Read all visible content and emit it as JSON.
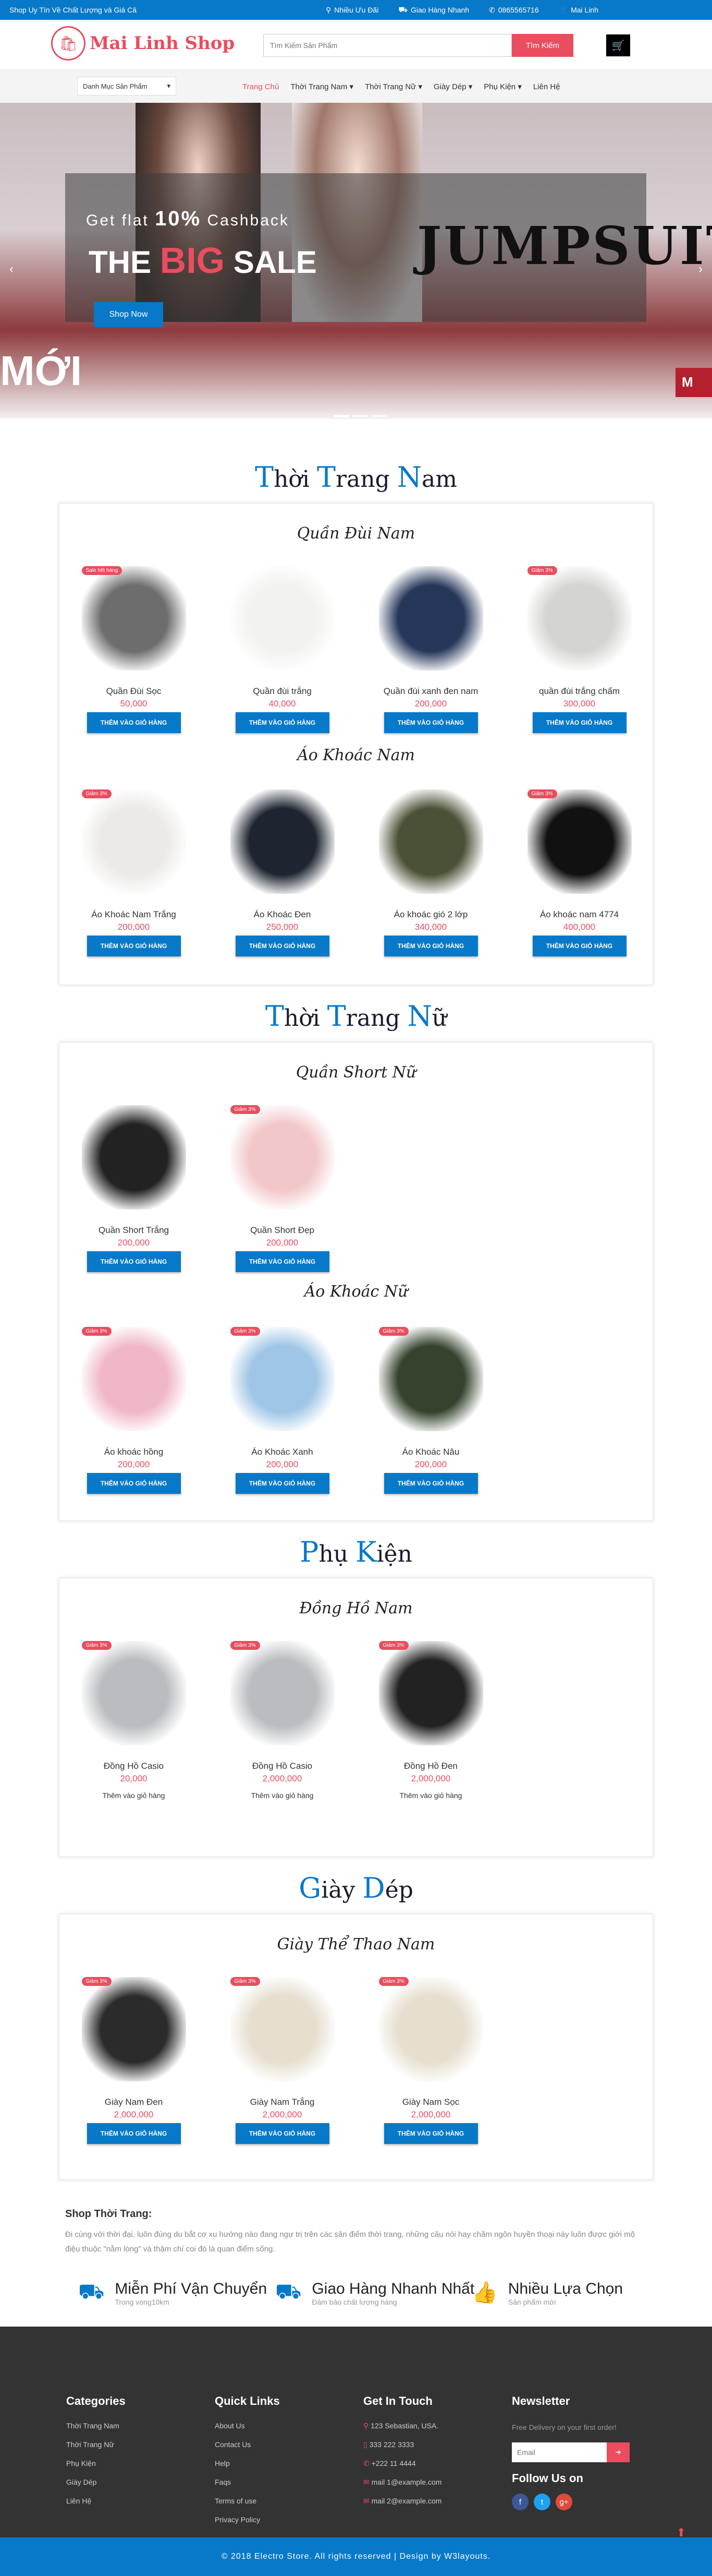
{
  "topbar": {
    "tagline": "Shop Uy Tín Về Chất Lượng và Giá Cả",
    "links": [
      {
        "icon": "map-marker-icon",
        "label": "Nhiều Ưu Đãi"
      },
      {
        "icon": "truck-icon",
        "label": "Giao Hàng Nhanh"
      },
      {
        "icon": "phone-icon",
        "label": "0865565716"
      },
      {
        "icon": "user-icon",
        "label": "Mai Linh"
      }
    ]
  },
  "header": {
    "logo_text": "Mai Linh Shop",
    "search_placeholder": "Tìm Kiếm Sản Phẩm",
    "search_button": "Tìm Kiếm"
  },
  "nav": {
    "category_dropdown": "Danh Mục Sản Phẩm",
    "menu": [
      "Trang Chủ",
      "Thời Trang Nam",
      "Thời Trang Nữ",
      "Giày Dép",
      "Phụ Kiện",
      "Liên Hệ"
    ],
    "active_index": 0
  },
  "banner": {
    "cashback_pre": "Get flat",
    "cashback_pct": "10%",
    "cashback_post": "Cashback",
    "sale_the": "THE",
    "sale_big": "BIG",
    "sale_word": "SALE",
    "jumpsuit": "JUMPSUIT",
    "shop_now": "Shop Now",
    "moi": "MỚI",
    "side_tab": "M"
  },
  "sections": {
    "men": {
      "title": "Thời Trang Nam",
      "cap1": "T",
      "rest1": "hời ",
      "cap2": "T",
      "rest2": "rang ",
      "cap3": "N",
      "rest3": "am"
    },
    "women": {
      "cap1": "T",
      "rest1": "hời ",
      "cap2": "T",
      "rest2": "rang ",
      "cap3": "N",
      "rest3": "ữ"
    },
    "acc": {
      "cap1": "P",
      "rest1": "hụ ",
      "cap2": "K",
      "rest2": "iện"
    },
    "shoes": {
      "cap1": "G",
      "rest1": "iày ",
      "cap2": "D",
      "rest2": "ép"
    }
  },
  "groups": {
    "men_shorts": {
      "title": "Quần Đùi Nam",
      "items": [
        {
          "name": "Quần Đùi Sọc",
          "price": "50,000",
          "badge": "Sale hết hàng"
        },
        {
          "name": "Quần đùi trắng",
          "price": "40,000",
          "badge": ""
        },
        {
          "name": "Quần đùi xanh đen nam",
          "price": "200,000",
          "badge": ""
        },
        {
          "name": "quần đùi trắng chấm",
          "price": "300,000",
          "badge": "Giảm 3%"
        }
      ]
    },
    "men_jackets": {
      "title": "Áo Khoác Nam",
      "items": [
        {
          "name": "Áo Khoác Nam Trắng",
          "price": "200,000",
          "badge": "Giảm 3%"
        },
        {
          "name": "Áo Khoác Đen",
          "price": "250,000",
          "badge": ""
        },
        {
          "name": "Áo khoác gió 2 lớp",
          "price": "340,000",
          "badge": ""
        },
        {
          "name": "Áo khoác nam 4774",
          "price": "400,000",
          "badge": "Giảm 3%"
        }
      ]
    },
    "women_shorts": {
      "title": "Quần Short Nữ",
      "items": [
        {
          "name": "Quần Short Trắng",
          "price": "200,000",
          "badge": ""
        },
        {
          "name": "Quần Short Đẹp",
          "price": "200,000",
          "badge": "Giảm 3%"
        }
      ]
    },
    "women_jackets": {
      "title": "Áo Khoác Nữ",
      "items": [
        {
          "name": "Áo khoác hồng",
          "price": "200,000",
          "badge": "Giảm 3%"
        },
        {
          "name": "Áo Khoác Xanh",
          "price": "200,000",
          "badge": "Giảm 3%"
        },
        {
          "name": "Áo Khoác Nâu",
          "price": "200,000",
          "badge": "Giảm 3%"
        }
      ]
    },
    "watches": {
      "title": "Đồng Hồ Nam",
      "items": [
        {
          "name": "Đồng Hồ Casio",
          "price": "20,000",
          "badge": "Giảm 3%"
        },
        {
          "name": "Đồng Hồ Casio",
          "price": "2,000,000",
          "badge": "Giảm 3%"
        },
        {
          "name": "Đồng Hồ Đen",
          "price": "2,000,000",
          "badge": "Giảm 3%"
        }
      ]
    },
    "sneakers": {
      "title": "Giày Thể Thao Nam",
      "items": [
        {
          "name": "Giày Nam Đen",
          "price": "2,000,000",
          "badge": "Giảm 3%"
        },
        {
          "name": "Giày Nam Trắng",
          "price": "2,000,000",
          "badge": "Giảm 3%"
        },
        {
          "name": "Giày Nam Sọc",
          "price": "2,000,000",
          "badge": "Giảm 3%"
        }
      ]
    }
  },
  "add_to_cart": "THÊM VÀO GIỎ HÀNG",
  "add_to_cart_text": "Thêm vào giỏ hàng",
  "about": {
    "title": "Shop Thời Trang:",
    "text": "Đi cùng với thời đại, luôn đúng du bắt cơ xu hướng nào đang ngự trị trên các sản điểm thời trang, những câu nói hay chăm ngôn huyền thoại này luôn được giới mộ điệu thuộc \"nằm lòng\" và thậm chí coi đó là quan điểm sống."
  },
  "features": [
    {
      "icon": "truck-icon",
      "title": "Miễn Phí Vận Chuyển",
      "sub": "Trong vòng10km"
    },
    {
      "icon": "delivery-icon",
      "title": "Giao Hàng Nhanh Nhất",
      "sub": "Đảm bảo chất lượng hàng"
    },
    {
      "icon": "thumbs-up-icon",
      "title": "Nhiều Lựa Chọn",
      "sub": "Sản phẩm mới"
    }
  ],
  "footer": {
    "categories": {
      "title": "Categories",
      "items": [
        "Thời Trang Nam",
        "Thời Trang Nữ",
        "Phụ Kiện",
        "Giày Dép",
        "Liên Hệ"
      ]
    },
    "quick": {
      "title": "Quick Links",
      "items": [
        "About Us",
        "Contact Us",
        "Help",
        "Faqs",
        "Terms of use",
        "Privacy Policy"
      ]
    },
    "touch": {
      "title": "Get In Touch",
      "items": [
        "123 Sebastian, USA.",
        "333 222 3333",
        "+222 11 4444",
        "mail 1@example.com",
        "mail 2@example.com"
      ]
    },
    "newsletter": {
      "title": "Newsletter",
      "text": "Free Delivery on your first order!",
      "placeholder": "Email",
      "follow": "Follow Us on"
    },
    "copyright": "© 2018 Electro Store. All rights reserved | Design by W3layouts."
  }
}
